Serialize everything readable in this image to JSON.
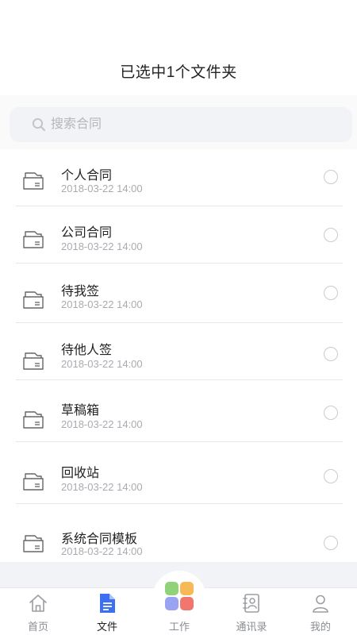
{
  "header": {
    "title": "已选中1个文件夹"
  },
  "search": {
    "placeholder": "搜索合同"
  },
  "folders": [
    {
      "name": "个人合同",
      "date": "2018-03-22 14:00"
    },
    {
      "name": "公司合同",
      "date": "2018-03-22 14:00"
    },
    {
      "name": "待我签",
      "date": "2018-03-22 14:00"
    },
    {
      "name": "待他人签",
      "date": "2018-03-22 14:00"
    },
    {
      "name": "草稿箱",
      "date": "2018-03-22 14:00"
    },
    {
      "name": "回收站",
      "date": "2018-03-22 14:00"
    },
    {
      "name": "系统合同模板",
      "date": "2018-03-22 14:00"
    }
  ],
  "tabbar": {
    "active": "文件",
    "tabs": [
      {
        "label": "首页",
        "icon": "home-icon"
      },
      {
        "label": "文件",
        "icon": "document-icon"
      },
      {
        "label": "工作",
        "icon": "work-grid-icon"
      },
      {
        "label": "通讯录",
        "icon": "contacts-icon"
      },
      {
        "label": "我的",
        "icon": "profile-icon"
      }
    ]
  },
  "colors": {
    "accent_blue": "#3d6ff2",
    "tile_green": "#8fd27a",
    "tile_orange": "#f6b955",
    "tile_purple": "#9aa2f2",
    "tile_red": "#f1776e"
  }
}
